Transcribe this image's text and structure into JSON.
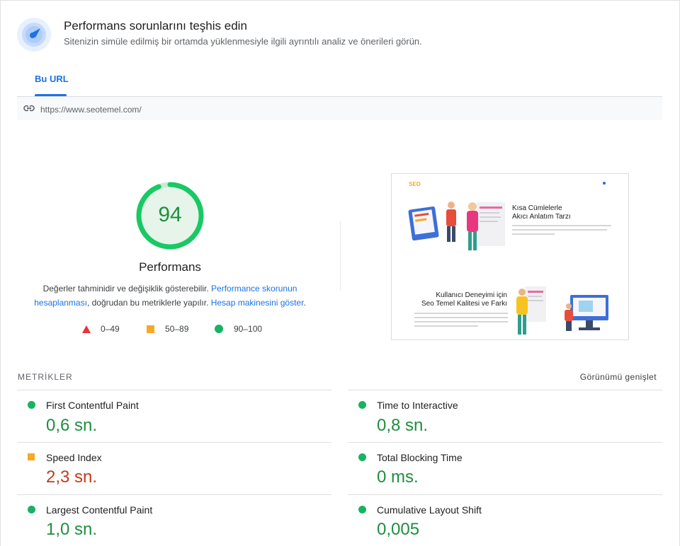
{
  "header": {
    "title": "Performans sorunlarını teşhis edin",
    "subtitle": "Sitenizin simüle edilmiş bir ortamda yüklenmesiyle ilgili ayrıntılı analiz ve önerileri görün."
  },
  "tabs": [
    {
      "label": "Bu URL",
      "active": true
    }
  ],
  "url": "https://www.seotemel.com/",
  "score": {
    "value": "94",
    "label": "Performans",
    "fraction": 0.94,
    "color": "#1e8e3e"
  },
  "notes": {
    "line1_text": "Değerler tahminidir ve değişiklik gösterebilir.",
    "line1_link": "Performance skorunun",
    "line2_link1": "hesaplanması",
    "line2_text": ", doğrudan bu metriklerle yapılır.",
    "line2_link2": "Hesap makinesini göster",
    "line2_end": "."
  },
  "legend": [
    {
      "range": "0–49",
      "shape": "triangle",
      "color": "#e8333b"
    },
    {
      "range": "50–89",
      "shape": "square",
      "color": "#f6a826"
    },
    {
      "range": "90–100",
      "shape": "circle",
      "color": "#18b361"
    }
  ],
  "thumbnail": {
    "logo": "SEO",
    "heading1_line1": "Kısa Cümlelerle",
    "heading1_line2": "Akıcı Anlatım Tarzı",
    "heading2_line1": "Kullanıcı Deneyimi için",
    "heading2_line2": "Seo Temel Kalitesi ve Farkı"
  },
  "metrics": {
    "heading": "METRİKLER",
    "expand_label": "Görünümü genişlet",
    "items": [
      {
        "label": "First Contentful Paint",
        "value": "0,6 sn.",
        "status": "good"
      },
      {
        "label": "Time to Interactive",
        "value": "0,8 sn.",
        "status": "good"
      },
      {
        "label": "Speed Index",
        "value": "2,3 sn.",
        "status": "average"
      },
      {
        "label": "Total Blocking Time",
        "value": "0 ms.",
        "status": "good"
      },
      {
        "label": "Largest Contentful Paint",
        "value": "1,0 sn.",
        "status": "good"
      },
      {
        "label": "Cumulative Layout Shift",
        "value": "0,005",
        "status": "good"
      }
    ]
  }
}
